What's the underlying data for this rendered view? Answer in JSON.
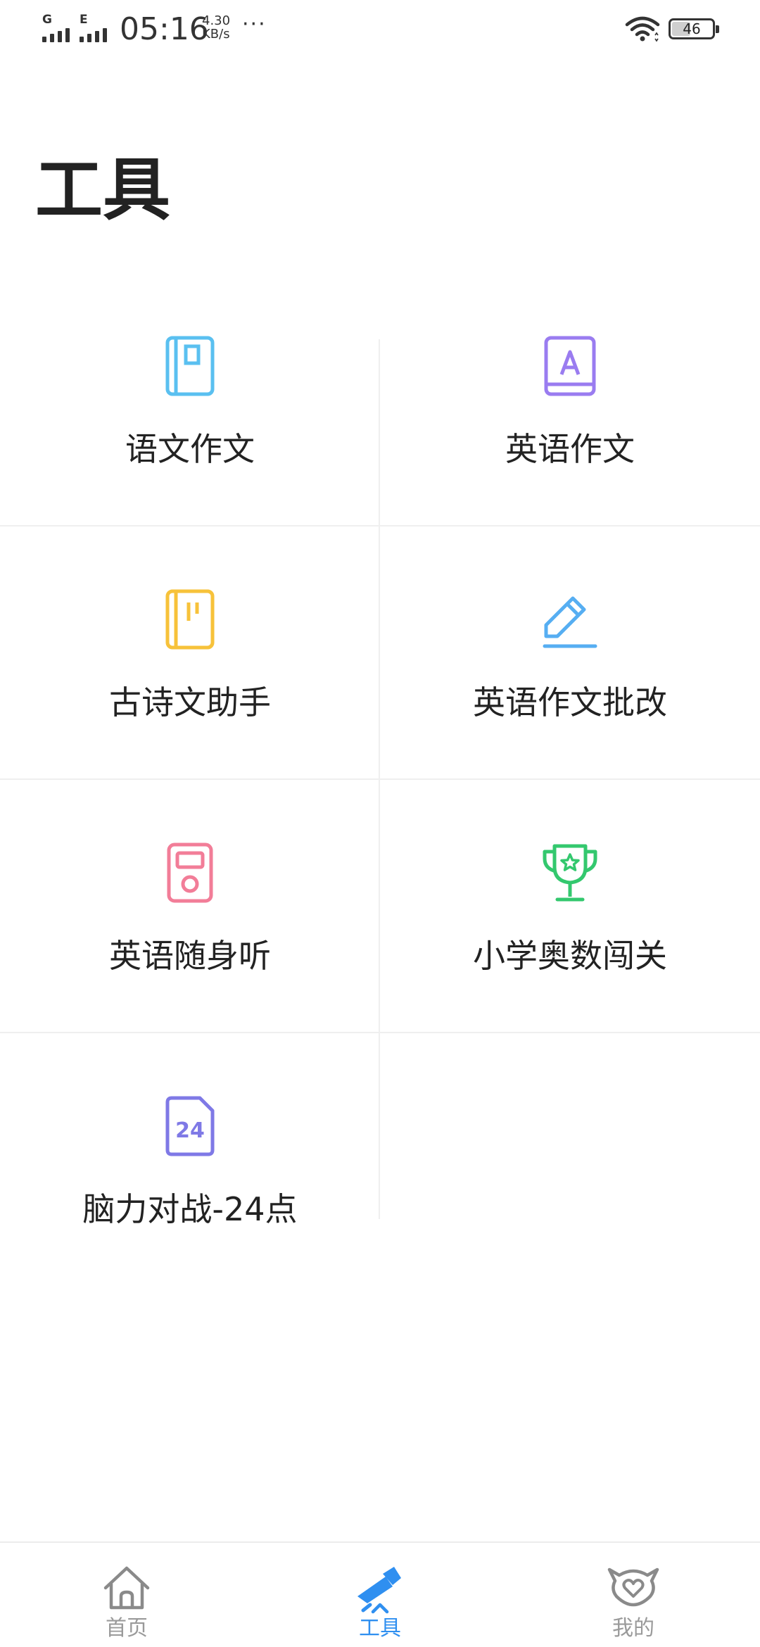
{
  "status_bar": {
    "signal1_label": "G",
    "signal2_label": "E",
    "time": "05:16",
    "speed_value": "4.30",
    "speed_unit": "KB/s",
    "more": "···",
    "battery_level": "46",
    "battery_fraction": 0.46
  },
  "page": {
    "title": "工具"
  },
  "tools": [
    {
      "label": "语文作文",
      "icon": "notebook-icon",
      "color": "#5ac0f0"
    },
    {
      "label": "英语作文",
      "icon": "english-book-icon",
      "color": "#9a7cf0"
    },
    {
      "label": "古诗文助手",
      "icon": "poetry-book-icon",
      "color": "#f7c23a"
    },
    {
      "label": "英语作文批改",
      "icon": "pencil-edit-icon",
      "color": "#56aef2"
    },
    {
      "label": "英语随身听",
      "icon": "audio-player-icon",
      "color": "#f27d98"
    },
    {
      "label": "小学奥数闯关",
      "icon": "trophy-icon",
      "color": "#33c86e"
    },
    {
      "label": "脑力对战-24点",
      "icon": "card-24-icon",
      "icon_text": "24",
      "color": "#7f79e6"
    }
  ],
  "bottom_nav": {
    "items": [
      {
        "label": "首页",
        "icon": "home-icon",
        "active": false
      },
      {
        "label": "工具",
        "icon": "tools-rocket-icon",
        "active": true
      },
      {
        "label": "我的",
        "icon": "heart-face-icon",
        "active": false
      }
    ]
  },
  "colors": {
    "accent": "#2f8ff0",
    "inactive": "#9a9a9a",
    "text": "#222222",
    "divider": "#efefef"
  }
}
